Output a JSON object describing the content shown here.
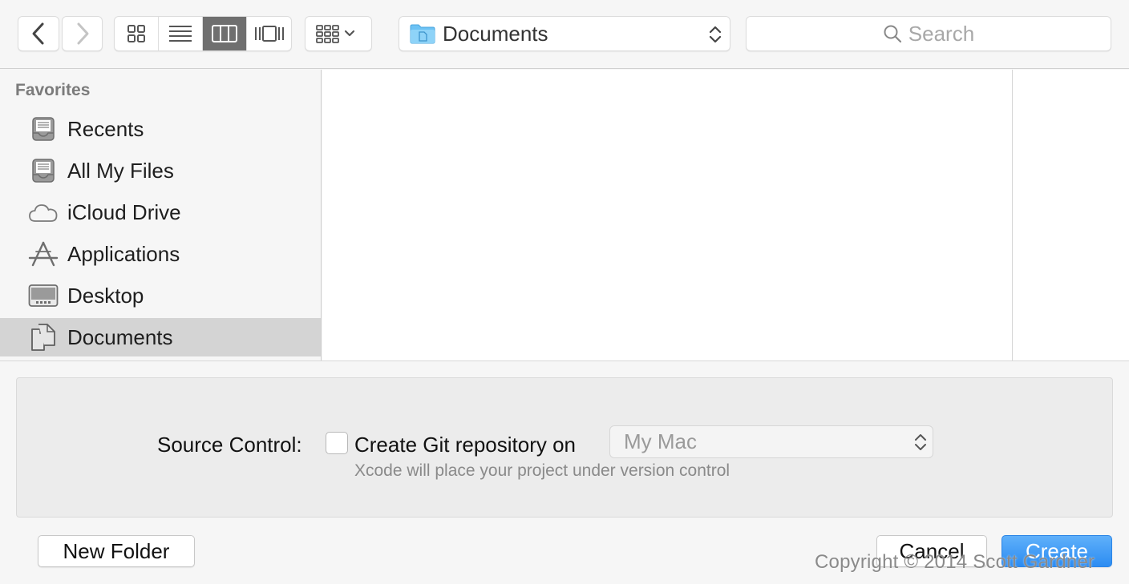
{
  "toolbar": {
    "back_icon": "chevron-left-icon",
    "forward_icon": "chevron-right-icon",
    "views": [
      {
        "icon": "icon-view-icon",
        "active": false
      },
      {
        "icon": "list-view-icon",
        "active": false
      },
      {
        "icon": "column-view-icon",
        "active": true
      },
      {
        "icon": "cover-flow-view-icon",
        "active": false
      }
    ],
    "arrange_icon": "arrange-grid-icon",
    "location": "Documents",
    "search_placeholder": "Search"
  },
  "sidebar": {
    "heading": "Favorites",
    "items": [
      {
        "label": "Recents",
        "icon": "recents-icon",
        "selected": false
      },
      {
        "label": "All My Files",
        "icon": "all-my-files-icon",
        "selected": false
      },
      {
        "label": "iCloud Drive",
        "icon": "cloud-icon",
        "selected": false
      },
      {
        "label": "Applications",
        "icon": "applications-icon",
        "selected": false
      },
      {
        "label": "Desktop",
        "icon": "desktop-icon",
        "selected": false
      },
      {
        "label": "Documents",
        "icon": "documents-icon",
        "selected": true
      }
    ]
  },
  "options": {
    "source_control_label": "Source Control:",
    "checkbox_label": "Create Git repository on",
    "checkbox_checked": false,
    "repository_location": "My Mac",
    "hint": "Xcode will place your project under version control"
  },
  "buttons": {
    "new_folder": "New Folder",
    "cancel": "Cancel",
    "create": "Create"
  },
  "watermark": "Copyright © 2014 Scott Gardner",
  "colors": {
    "accent": "#2c8cf2",
    "selected_row": "#d4d4d4",
    "folder_blue": "#6cc2f4"
  }
}
